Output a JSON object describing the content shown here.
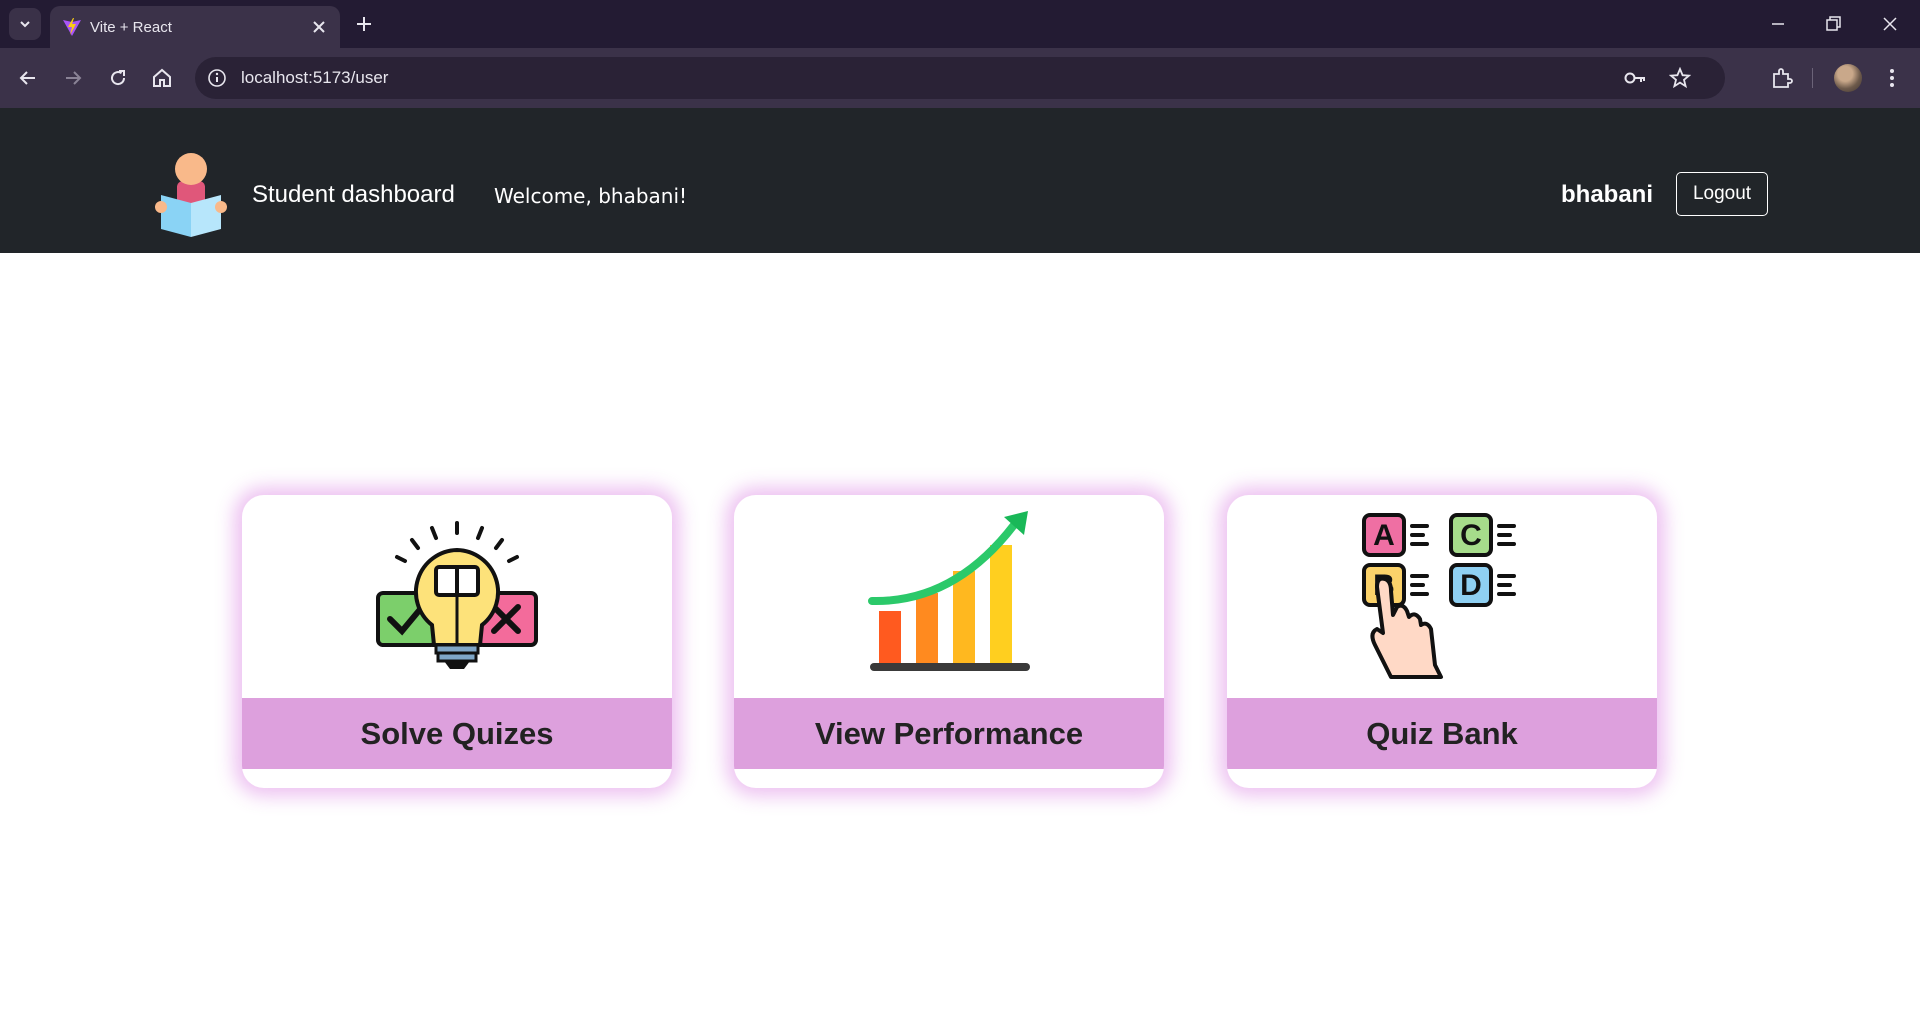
{
  "browser": {
    "tab_title": "Vite + React",
    "url": "localhost:5173/user"
  },
  "navbar": {
    "brand_title": "Student dashboard",
    "welcome_text": "Welcome, bhabani!",
    "username": "bhabani",
    "logout_label": "Logout"
  },
  "cards": [
    {
      "label": "Solve Quizes",
      "icon": "lightbulb-quiz-icon"
    },
    {
      "label": "View Performance",
      "icon": "growth-chart-icon"
    },
    {
      "label": "Quiz Bank",
      "icon": "abcd-choice-icon"
    }
  ],
  "colors": {
    "navbar_bg": "#212529",
    "card_band": "#dda0dd",
    "card_glow": "#d778e1"
  }
}
